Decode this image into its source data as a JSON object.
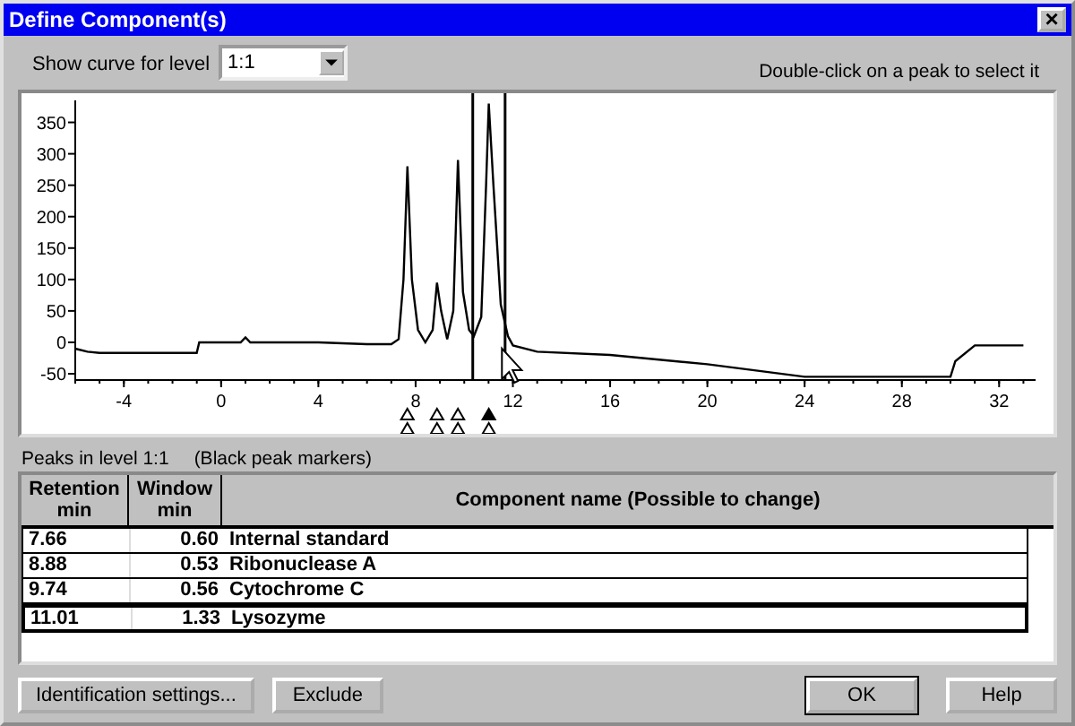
{
  "window": {
    "title": "Define Component(s)",
    "close": "×"
  },
  "level_select": {
    "label": "Show curve for level",
    "value": "1:1"
  },
  "hint": "Double-click on a peak to select it",
  "chart": {
    "chart_data": {
      "type": "line",
      "xlim": [
        -6,
        33.5
      ],
      "ylim": [
        -60,
        385
      ],
      "xticks": [
        -4,
        0,
        4,
        8,
        12,
        16,
        20,
        24,
        28,
        32
      ],
      "yticks": [
        -50,
        0,
        50,
        100,
        150,
        200,
        250,
        300,
        350
      ],
      "ref_lines": [
        {
          "axis": "x",
          "value": 10.35
        },
        {
          "axis": "x",
          "value": 11.68
        }
      ],
      "x": [
        -6,
        -5.5,
        -5,
        -2,
        -1,
        -0.9,
        0,
        0.8,
        1,
        1.2,
        4,
        6,
        7,
        7.3,
        7.5,
        7.66,
        7.85,
        8.1,
        8.4,
        8.7,
        8.88,
        9.05,
        9.3,
        9.55,
        9.74,
        9.95,
        10.2,
        10.4,
        10.7,
        10.9,
        11.01,
        11.2,
        11.5,
        11.8,
        12,
        13,
        16,
        20,
        24,
        30,
        30.2,
        31,
        33
      ],
      "series": [
        {
          "color": "#000000",
          "values": [
            -10,
            -15,
            -17,
            -17,
            -17,
            0,
            0,
            0,
            8,
            0,
            0,
            -3,
            -3,
            5,
            100,
            280,
            100,
            20,
            0,
            20,
            95,
            50,
            5,
            50,
            290,
            80,
            20,
            10,
            40,
            250,
            380,
            250,
            60,
            10,
            -5,
            -15,
            -20,
            -35,
            -55,
            -55,
            -30,
            -5,
            -5
          ]
        }
      ]
    }
  },
  "peaks_label": "Peaks in level 1:1",
  "peaks_note": "(Black peak markers)",
  "table": {
    "columns": [
      {
        "title": "Retention",
        "unit": "min"
      },
      {
        "title": "Window",
        "unit": "min"
      },
      {
        "title": "Component name (Possible to change)"
      }
    ],
    "rows": [
      {
        "retention": "7.66",
        "window": "0.60",
        "name": "Internal standard",
        "selected": false
      },
      {
        "retention": "8.88",
        "window": "0.53",
        "name": "Ribonuclease A",
        "selected": false
      },
      {
        "retention": "9.74",
        "window": "0.56",
        "name": "Cytochrome C",
        "selected": false
      },
      {
        "retention": "11.01",
        "window": "1.33",
        "name": "Lysozyme",
        "selected": true
      }
    ]
  },
  "buttons": {
    "left": [
      "Identification settings...",
      "Exclude"
    ],
    "right": [
      "OK",
      "Help"
    ]
  }
}
